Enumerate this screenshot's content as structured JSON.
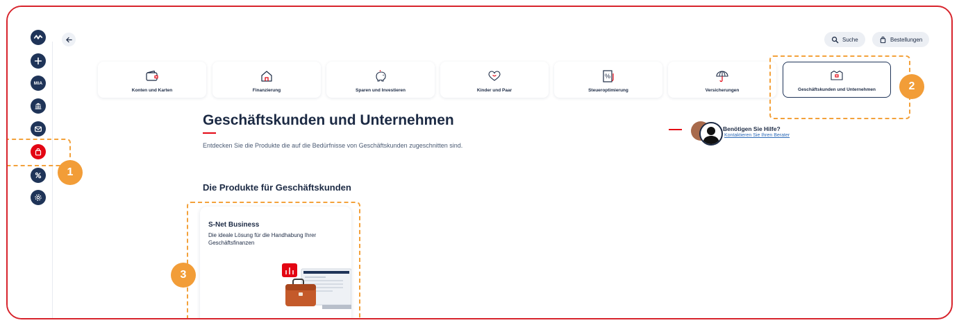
{
  "header": {
    "search_label": "Suche",
    "orders_label": "Bestellungen"
  },
  "sidebar": {
    "items": [
      {
        "icon": "activity-icon"
      },
      {
        "icon": "plus-icon"
      },
      {
        "icon": "mia-icon",
        "text": "MIA"
      },
      {
        "icon": "bank-icon"
      },
      {
        "icon": "mail-icon"
      },
      {
        "icon": "shopping-bag-icon",
        "active": true
      },
      {
        "icon": "percent-icon"
      },
      {
        "icon": "settings-icon"
      }
    ]
  },
  "categories": [
    {
      "label": "Konten und Karten",
      "icon": "wallet-icon"
    },
    {
      "label": "Finanzierung",
      "icon": "house-icon"
    },
    {
      "label": "Sparen und Investieren",
      "icon": "piggy-bank-icon"
    },
    {
      "label": "Kinder und Paar",
      "icon": "heart-icon"
    },
    {
      "label": "Steueroptimierung",
      "icon": "tax-percent-icon"
    },
    {
      "label": "Versicherungen",
      "icon": "umbrella-icon"
    },
    {
      "label": "Geschäftskunden und Unternehmen",
      "icon": "business-icon",
      "selected": true
    }
  ],
  "page": {
    "title": "Geschäftskunden und Unternehmen",
    "subtitle": "Entdecken Sie die Produkte die auf die Bedürfnisse von Geschäftskunden zugeschnitten sind."
  },
  "help": {
    "title": "Benötigen Sie Hilfe?",
    "link": "Kontaktieren Sie Ihren Berater"
  },
  "products_section": {
    "title": "Die Produkte für Geschäftskunden",
    "products": [
      {
        "title": "S-Net Business",
        "description": "Die ideale Lösung für die Handhabung Ihrer Geschäftsfinanzen"
      }
    ]
  },
  "annotations": [
    "1",
    "2",
    "3"
  ],
  "colors": {
    "brand_red": "#e30613",
    "navy": "#1f3458",
    "annotation_orange": "#f29d38",
    "frame_red": "#d7232b"
  }
}
